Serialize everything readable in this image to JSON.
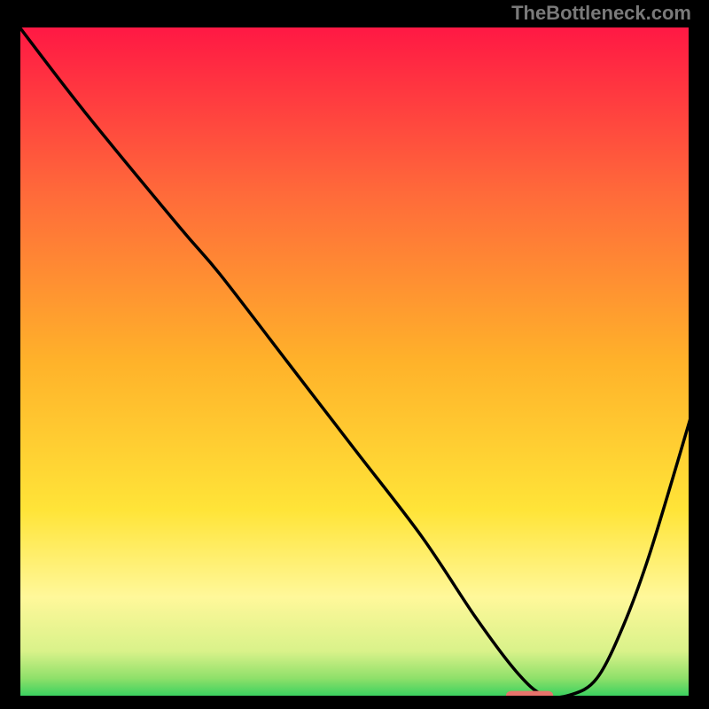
{
  "watermark": "TheBottleneck.com",
  "chart_data": {
    "type": "line",
    "title": "",
    "xlabel": "",
    "ylabel": "",
    "xlim": [
      0,
      100
    ],
    "ylim": [
      0,
      100
    ],
    "grid": false,
    "legend": false,
    "background_gradient": {
      "stops": [
        {
          "pos": 0.0,
          "color": "#ff1744"
        },
        {
          "pos": 0.25,
          "color": "#ff6a3a"
        },
        {
          "pos": 0.5,
          "color": "#ffb22a"
        },
        {
          "pos": 0.72,
          "color": "#ffe438"
        },
        {
          "pos": 0.85,
          "color": "#fff89a"
        },
        {
          "pos": 0.93,
          "color": "#d9f28a"
        },
        {
          "pos": 0.97,
          "color": "#8fe06a"
        },
        {
          "pos": 1.0,
          "color": "#2fcf5e"
        }
      ]
    },
    "series": [
      {
        "name": "bottleneck-curve",
        "color": "#000000",
        "x": [
          0,
          10,
          24,
          30,
          40,
          50,
          60,
          68,
          74,
          78,
          82,
          86,
          90,
          94,
          100
        ],
        "y": [
          100,
          87,
          70,
          63,
          50,
          37,
          24,
          12,
          4,
          0.5,
          0.5,
          3,
          11,
          22,
          42
        ]
      }
    ],
    "marker": {
      "name": "optimal-marker",
      "color": "#e8736c",
      "x": 76,
      "y": 0.5,
      "width": 7,
      "height": 1.2
    }
  }
}
